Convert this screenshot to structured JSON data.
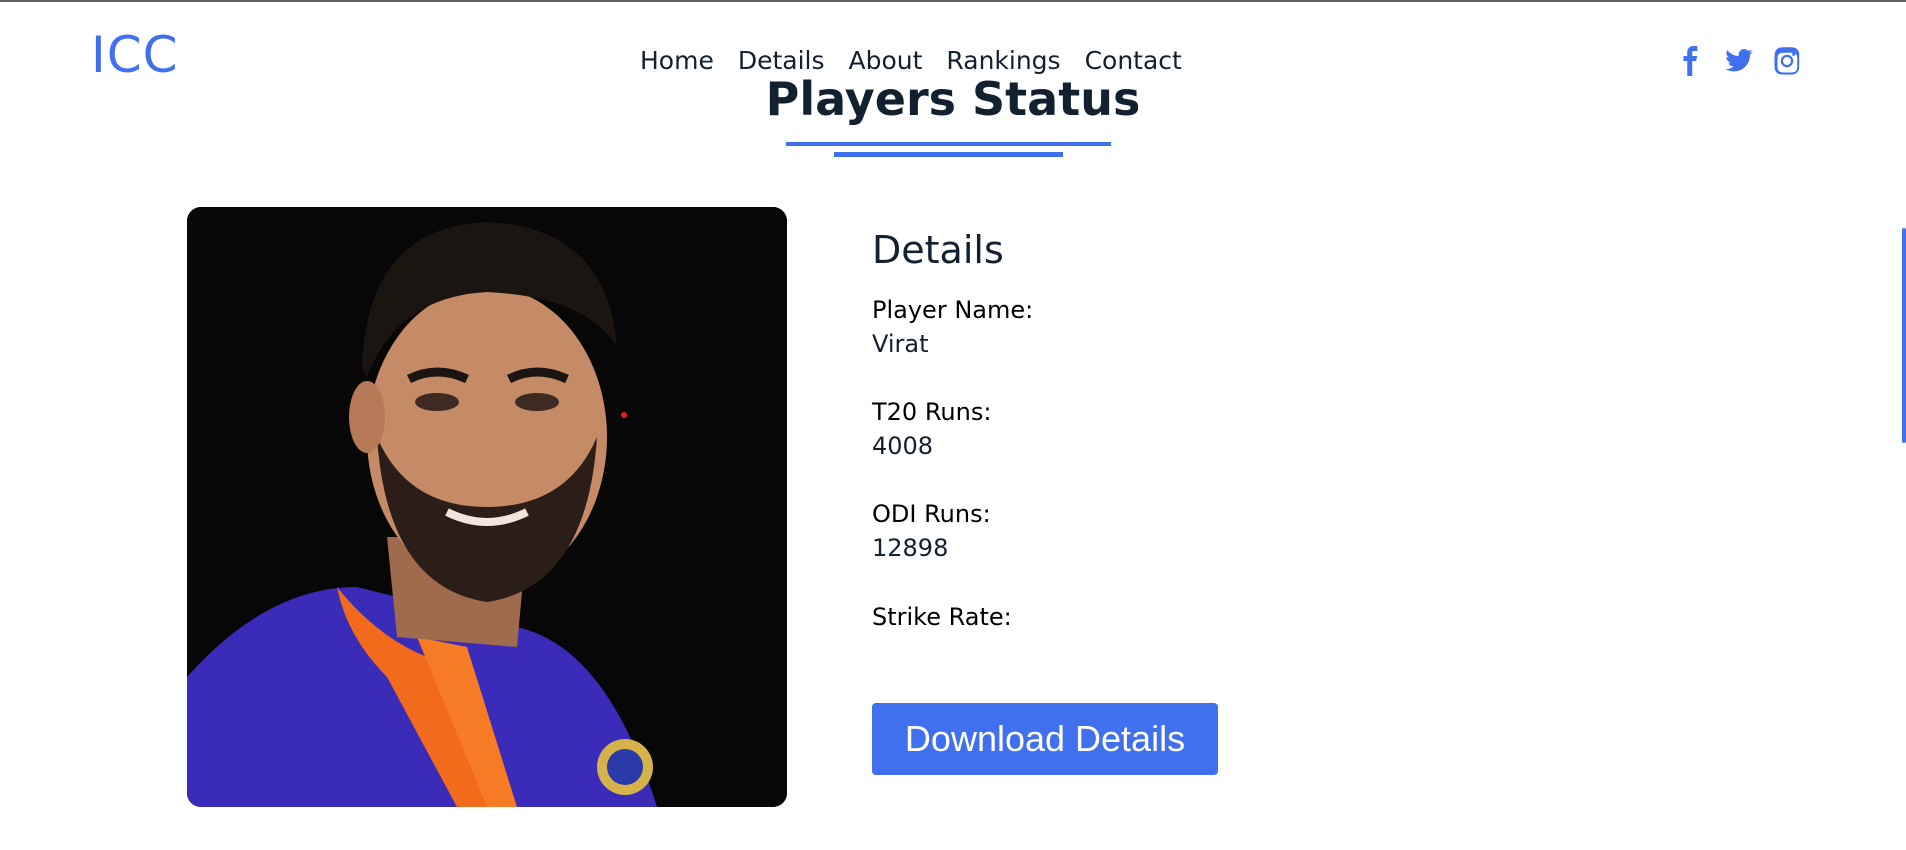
{
  "header": {
    "logo": "ICC",
    "nav": [
      "Home",
      "Details",
      "About",
      "Rankings",
      "Contact"
    ],
    "social_icons": [
      "facebook-icon",
      "twitter-icon",
      "instagram-icon"
    ]
  },
  "page": {
    "title": "Players Status"
  },
  "details": {
    "heading": "Details",
    "fields": [
      {
        "label": "Player Name:",
        "value": "Virat"
      },
      {
        "label": "T20 Runs:",
        "value": "4008"
      },
      {
        "label": "ODI Runs:",
        "value": "12898"
      },
      {
        "label": "Strike Rate:",
        "value": ""
      }
    ],
    "download_label": "Download Details"
  },
  "colors": {
    "accent": "#4070ee",
    "text": "#12202f",
    "photo_background": "#070707"
  }
}
